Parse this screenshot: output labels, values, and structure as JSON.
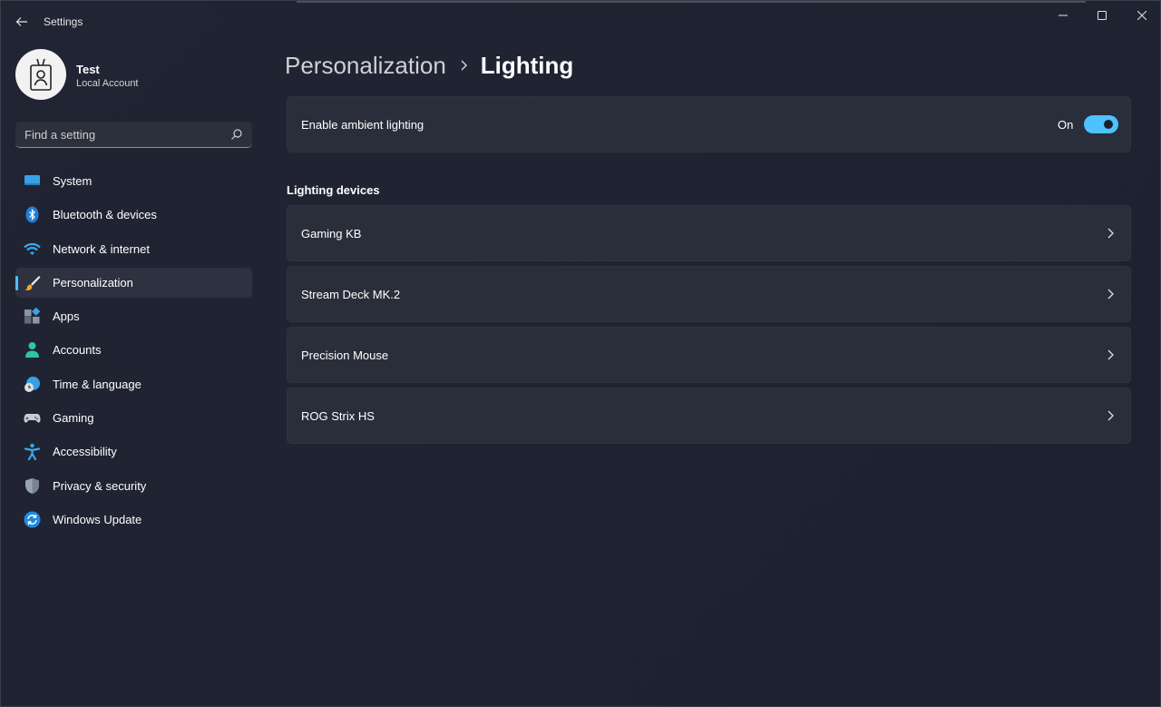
{
  "app": {
    "title": "Settings"
  },
  "user": {
    "name": "Test",
    "account_type": "Local Account"
  },
  "search": {
    "placeholder": "Find a setting"
  },
  "sidebar": {
    "items": [
      {
        "label": "System",
        "icon": "monitor-icon"
      },
      {
        "label": "Bluetooth & devices",
        "icon": "bluetooth-icon"
      },
      {
        "label": "Network & internet",
        "icon": "wifi-icon"
      },
      {
        "label": "Personalization",
        "icon": "paintbrush-icon",
        "active": true
      },
      {
        "label": "Apps",
        "icon": "apps-icon"
      },
      {
        "label": "Accounts",
        "icon": "person-icon"
      },
      {
        "label": "Time & language",
        "icon": "globe-clock-icon"
      },
      {
        "label": "Gaming",
        "icon": "gamepad-icon"
      },
      {
        "label": "Accessibility",
        "icon": "accessibility-icon"
      },
      {
        "label": "Privacy & security",
        "icon": "shield-icon"
      },
      {
        "label": "Windows Update",
        "icon": "refresh-icon"
      }
    ]
  },
  "breadcrumb": {
    "parent": "Personalization",
    "current": "Lighting"
  },
  "ambient": {
    "label": "Enable ambient lighting",
    "state": "On",
    "enabled": true
  },
  "devices": {
    "title": "Lighting devices",
    "items": [
      {
        "label": "Gaming KB"
      },
      {
        "label": "Stream Deck MK.2"
      },
      {
        "label": "Precision Mouse"
      },
      {
        "label": "ROG Strix HS"
      }
    ]
  },
  "colors": {
    "accent": "#4cc2ff",
    "background": "#1f2330",
    "card": "#2a2e3b"
  }
}
